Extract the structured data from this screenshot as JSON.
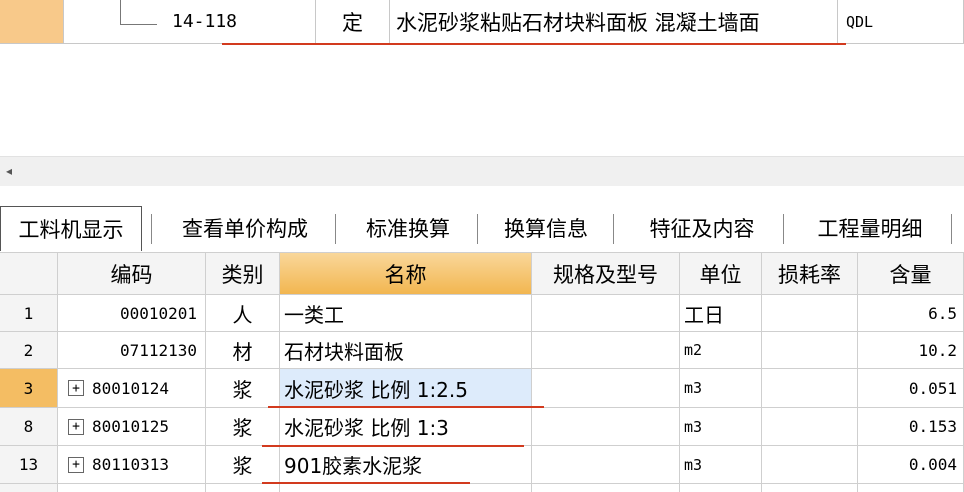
{
  "quota_row": {
    "code": "14-118",
    "type": "定",
    "name": "水泥砂浆粘贴石材块料面板 混凝土墙面",
    "unit": "QDL"
  },
  "scroll_arrow": "◂",
  "tabs": [
    {
      "label": "工料机显示",
      "active": true
    },
    {
      "label": "查看单价构成"
    },
    {
      "label": "标准换算"
    },
    {
      "label": "换算信息"
    },
    {
      "label": "特征及内容"
    },
    {
      "label": "工程量明细"
    }
  ],
  "grid": {
    "headers": {
      "code": "编码",
      "kind": "类别",
      "name": "名称",
      "spec": "规格及型号",
      "unit": "单位",
      "loss": "损耗率",
      "qty": "含量"
    },
    "rows": [
      {
        "num": "1",
        "code": "00010201",
        "kind": "人",
        "name": "一类工",
        "spec": "",
        "unit": "工日",
        "loss": "",
        "qty": "6.5"
      },
      {
        "num": "2",
        "code": "07112130",
        "kind": "材",
        "name": "石材块料面板",
        "spec": "",
        "unit": "m2",
        "loss": "",
        "qty": "10.2"
      },
      {
        "num": "3",
        "code": "80010124",
        "kind": "浆",
        "name": "水泥砂浆 比例 1:2.5",
        "spec": "",
        "unit": "m3",
        "loss": "",
        "qty": "0.051",
        "expand": "+"
      },
      {
        "num": "8",
        "code": "80010125",
        "kind": "浆",
        "name": "水泥砂浆 比例 1:3",
        "spec": "",
        "unit": "m3",
        "loss": "",
        "qty": "0.153",
        "expand": "+"
      },
      {
        "num": "13",
        "code": "80110313",
        "kind": "浆",
        "name": "901胶素水泥浆",
        "spec": "",
        "unit": "m3",
        "loss": "",
        "qty": "0.004",
        "expand": "+"
      }
    ]
  },
  "colors": {
    "selected_row_marker": "#f4bd63",
    "name_header": "#f2b650",
    "highlight_cell": "#ddebfb",
    "annotation_line": "#d23a1e"
  }
}
